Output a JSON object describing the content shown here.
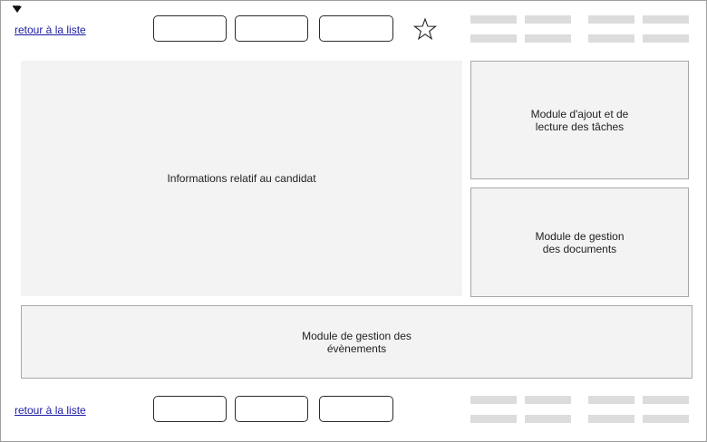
{
  "nav": {
    "back_link_top": "retour à la liste",
    "back_link_bottom": "retour à la liste"
  },
  "icons": {
    "corner": "corner-arrow-icon",
    "favorite": "star-icon"
  },
  "panels": {
    "candidate_info": "Informations relatif au candidat",
    "tasks": "Module d'ajout et de\nlecture des tâches",
    "documents": "Module de gestion\ndes documents",
    "events": "Module de gestion des\névènements"
  },
  "colors": {
    "panel_bg": "#f3f3f3",
    "placeholder": "#dcdcdc",
    "link": "#1a1aa6"
  }
}
